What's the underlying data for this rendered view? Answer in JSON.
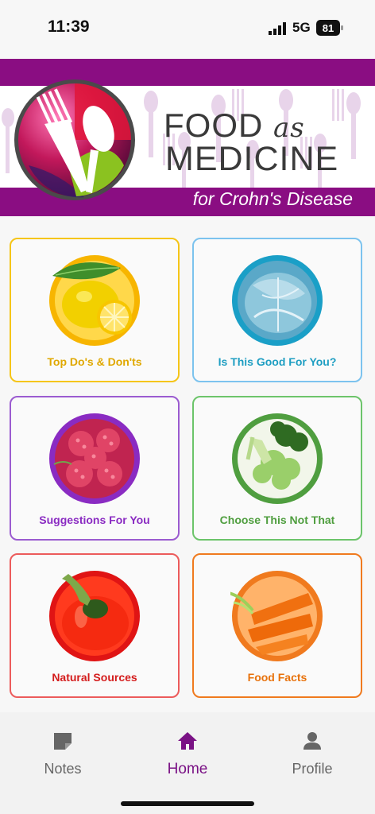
{
  "status_bar": {
    "time": "11:39",
    "network": "5G",
    "battery": "81"
  },
  "banner": {
    "title_food": "FOOD",
    "title_as": "as",
    "title_medicine": "MEDICINE",
    "subtitle": "for Crohn's Disease"
  },
  "tiles": [
    {
      "label": "Top Do's & Don'ts",
      "color": "#f5c518",
      "text_color": "#e0a800",
      "icon": "lemon-icon"
    },
    {
      "label": "Is This Good For You?",
      "color": "#7cc3ee",
      "text_color": "#1e9ec2",
      "icon": "cabbage-icon"
    },
    {
      "label": "Suggestions For You",
      "color": "#9b5bd0",
      "text_color": "#8a2bc2",
      "icon": "raspberry-icon"
    },
    {
      "label": "Choose This Not That",
      "color": "#6cc46a",
      "text_color": "#4f9e3f",
      "icon": "broccoli-icon"
    },
    {
      "label": "Natural Sources",
      "color": "#ec5b5b",
      "text_color": "#d41c1c",
      "icon": "pepper-icon"
    },
    {
      "label": "Food Facts",
      "color": "#f07a1e",
      "text_color": "#e8720c",
      "icon": "carrot-icon"
    }
  ],
  "nav": {
    "notes_label": "Notes",
    "home_label": "Home",
    "profile_label": "Profile",
    "active": "Home",
    "active_color": "#7a1285",
    "inactive_color": "#666666"
  }
}
